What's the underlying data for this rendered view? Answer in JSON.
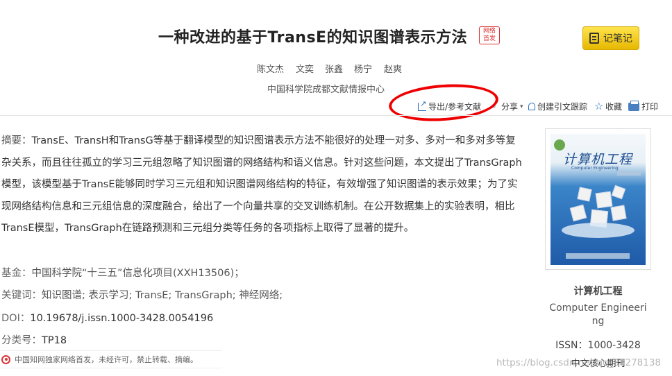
{
  "header": {
    "title": "一种改进的基于TransE的知识图谱表示方法",
    "badge_line1": "网络",
    "badge_line2": "首发",
    "note_button": "记笔记"
  },
  "authors": [
    "陈文杰",
    "文奕",
    "张鑫",
    "杨宁",
    "赵爽"
  ],
  "organization": "中国科学院成都文献情报中心",
  "toolbar": {
    "export": "导出/参考文献",
    "share": "分享",
    "share_arrow": "▾",
    "track": "创建引文跟踪",
    "favorite": "收藏",
    "print": "打印"
  },
  "abstract": {
    "label": "摘要：",
    "text": "TransE、TransH和TransG等基于翻译模型的知识图谱表示方法不能很好的处理一对多、多对一和多对多等复杂关系，而且往往孤立的学习三元组忽略了知识图谱的网络结构和语义信息。针对这些问题，本文提出了TransGraph模型，该模型基于TransE能够同时学习三元组和知识图谱网络结构的特征，有效增强了知识图谱的表示效果；为了实现网络结构信息和三元组信息的深度融合，给出了一个向量共享的交叉训练机制。在公开数据集上的实验表明，相比TransE模型，TransGraph在链路预测和三元组分类等任务的各项指标上取得了显著的提升。"
  },
  "meta": {
    "fund_label": "基金：",
    "fund_value": "中国科学院“十三五”信息化项目(XXH13506)；",
    "keywords_label": "关键词：",
    "keywords_value": "知识图谱; 表示学习; TransE; TransGraph; 神经网络;",
    "doi_label": "DOI：",
    "doi_value": "10.19678/j.issn.1000-3428.0054196",
    "class_label": "分类号：",
    "class_value": "TP18"
  },
  "notice": "中国知网独家网络首发，未经许可，禁止转载、摘编。",
  "journal": {
    "cover_title": "计算机工程",
    "cover_subtitle": "Computer Engineering",
    "name": "计算机工程",
    "name_en": "Computer Engineering",
    "issn": "ISSN：1000-3428",
    "core": "中文核心期刊"
  },
  "watermark": "https://blog.csdn.net/qq_38278138",
  "colors": {
    "annotation_circle": "#e00000",
    "note_button": "#f5cf1a",
    "badge": "#dd3333",
    "link_blue": "#2a6ebb"
  }
}
